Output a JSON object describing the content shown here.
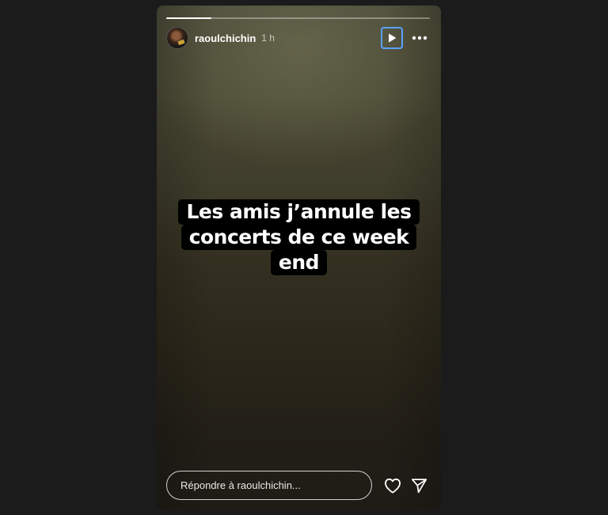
{
  "story": {
    "progress": 0.17,
    "username": "raoulchichin",
    "time": "1 h",
    "caption_lines": [
      "Les amis j’annule les",
      "concerts de ce week",
      "end"
    ]
  },
  "footer": {
    "reply_placeholder": "Répondre à raoulchichin..."
  },
  "icons": {
    "play": "play-icon",
    "more": "more-horizontal-icon",
    "heart": "heart-icon",
    "send": "send-icon"
  },
  "colors": {
    "focus_ring": "#5aa1ff",
    "caption_bg": "#000000",
    "text": "#ffffff"
  }
}
